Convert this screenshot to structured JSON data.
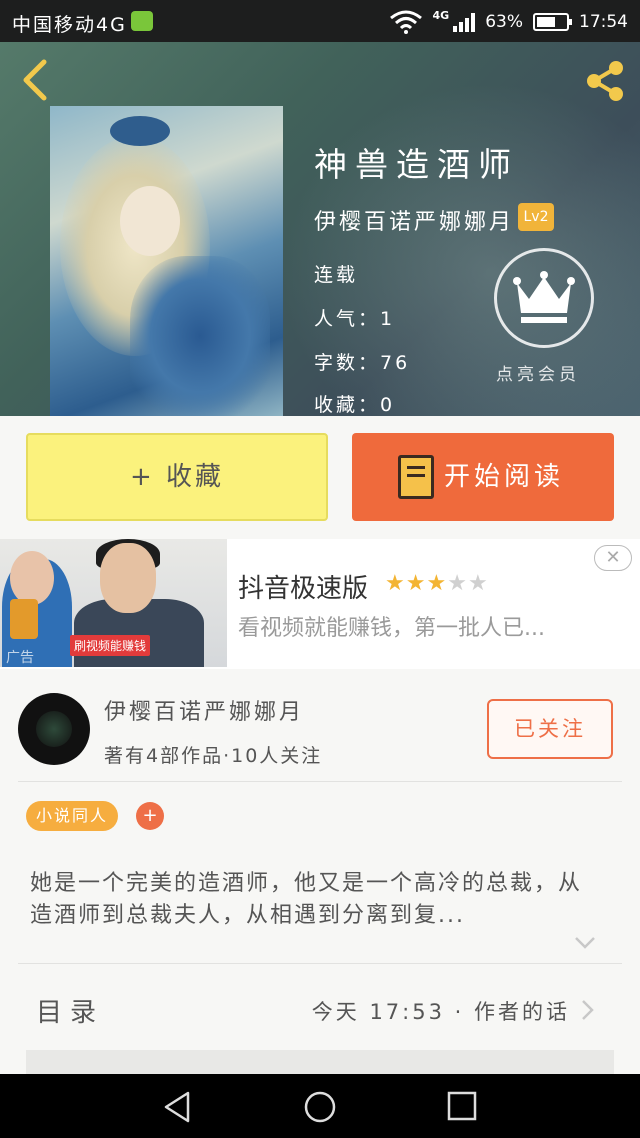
{
  "status_bar": {
    "carrier": "中国移动4G",
    "network": "4G",
    "battery": "63%",
    "battery_level": 0.63,
    "time": "17:54"
  },
  "book": {
    "title": "神兽造酒师",
    "author": "伊樱百诺严娜娜月",
    "level": "Lv2",
    "status": "连载",
    "popularity": "人气：1",
    "word_count": "字数：76",
    "favorites": "收藏：0",
    "vip_label": "点亮会员"
  },
  "actions": {
    "favorite_label": "+ 收藏",
    "read_label": "开始阅读"
  },
  "ad": {
    "title": "抖音极速版",
    "rating": 3,
    "rating_max": 5,
    "subtitle": "看视频就能赚钱，第一批人已...",
    "image_caption": "刷视频能赚钱",
    "image_tag": "广告",
    "close_glyph": "✕"
  },
  "author_card": {
    "name": "伊樱百诺严娜娜月",
    "works": "著有4部作品·10人关注",
    "follow_label": "已关注",
    "tag": "小说同人",
    "tag_add": "+",
    "synopsis": "她是一个完美的造酒师，他又是一个高冷的总裁，从造酒师到总裁夫人，从相遇到分离到复..."
  },
  "toc": {
    "label": "目录",
    "update": "今天 17:53 · 作者的话"
  },
  "icons": {
    "back": "back-arrow-icon",
    "share": "share-icon",
    "crown": "crown-icon",
    "book": "book-icon"
  },
  "colors": {
    "accent_orange": "#ef6a3c",
    "favorite_yellow": "#fbf27d",
    "tag_orange": "#f6ad3f",
    "level_badge": "#f1b43a",
    "star": "#f3b433"
  }
}
